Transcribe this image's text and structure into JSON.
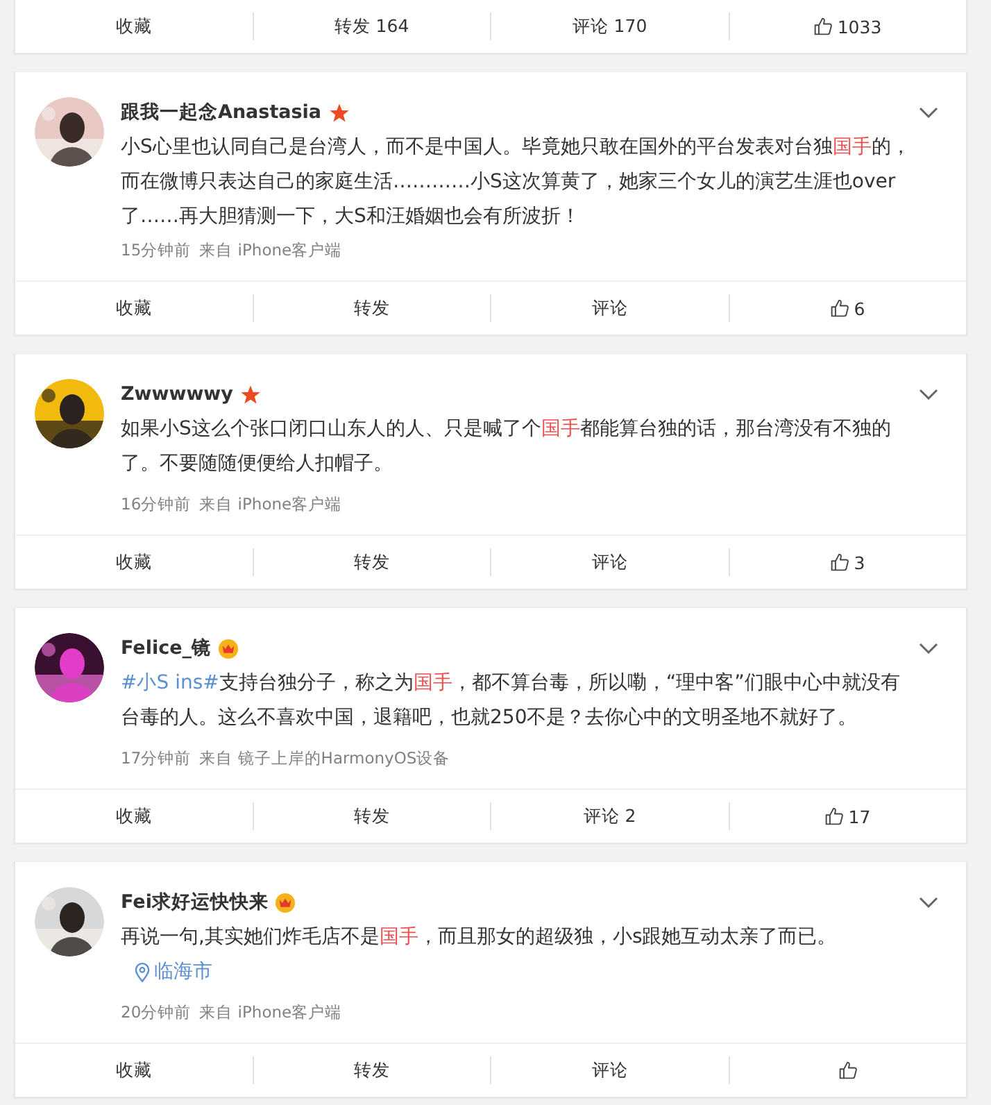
{
  "top_card": {
    "actions": [
      {
        "kind": "favorite",
        "label": "收藏"
      },
      {
        "kind": "repost",
        "label": "转发 164"
      },
      {
        "kind": "comment",
        "label": "评论 170"
      },
      {
        "kind": "like",
        "count": "1033"
      }
    ]
  },
  "comments": [
    {
      "name": "跟我一起念Anastasia",
      "badge": {
        "kind": "star"
      },
      "text": [
        {
          "kind": "plain",
          "text": "小S心里也认同自己是台湾人，而不是中国人。毕竟她只敢在国外的平台发表对台独"
        },
        {
          "kind": "keyword",
          "text": "国手"
        },
        {
          "kind": "plain",
          "text": "的，而在微博只表达自己的家庭生活…………小S这次算黄了，她家三个女儿的演艺生涯也over了……再大胆猜测一下，大S和汪婚姻也会有所波折！"
        }
      ],
      "time": "15分钟前",
      "source": "来自 iPhone客户端",
      "actions": [
        {
          "kind": "favorite",
          "label": "收藏"
        },
        {
          "kind": "repost",
          "label": "转发"
        },
        {
          "kind": "comment",
          "label": "评论"
        },
        {
          "kind": "like",
          "count": "6"
        }
      ]
    },
    {
      "name": "Zwwwwwy",
      "badge": {
        "kind": "star"
      },
      "text": [
        {
          "kind": "plain",
          "text": "如果小S这么个张口闭口山东人的人、只是喊了个"
        },
        {
          "kind": "keyword",
          "text": "国手"
        },
        {
          "kind": "plain",
          "text": "都能算台独的话，那台湾没有不独的了。不要随随便便给人扣帽子。"
        }
      ],
      "time": "16分钟前",
      "source": "来自 iPhone客户端",
      "actions": [
        {
          "kind": "favorite",
          "label": "收藏"
        },
        {
          "kind": "repost",
          "label": "转发"
        },
        {
          "kind": "comment",
          "label": "评论"
        },
        {
          "kind": "like",
          "count": "3"
        }
      ]
    },
    {
      "name": "Felice_镜",
      "badge": {
        "kind": "crown"
      },
      "text": [
        {
          "kind": "topic",
          "text": "#小S ins#"
        },
        {
          "kind": "plain",
          "text": "支持台独分子，称之为"
        },
        {
          "kind": "keyword",
          "text": "国手"
        },
        {
          "kind": "plain",
          "text": "，都不算台毒，所以嘞，“理中客”们眼中心中就没有台毒的人。这么不喜欢中国，退籍吧，也就250不是？去你心中的文明圣地不就好了。"
        }
      ],
      "time": "17分钟前",
      "source": "来自 镜子上岸的HarmonyOS设备",
      "actions": [
        {
          "kind": "favorite",
          "label": "收藏"
        },
        {
          "kind": "repost",
          "label": "转发"
        },
        {
          "kind": "comment",
          "label": "评论 2"
        },
        {
          "kind": "like",
          "count": "17"
        }
      ]
    },
    {
      "name": "Fei求好运快快来",
      "badge": {
        "kind": "crown"
      },
      "text": [
        {
          "kind": "plain",
          "text": "再说一句,其实她们炸毛店不是"
        },
        {
          "kind": "keyword",
          "text": "国手"
        },
        {
          "kind": "plain",
          "text": "，而且那女的超级独，小s跟她互动太亲了而已。"
        }
      ],
      "location": "临海市",
      "time": "20分钟前",
      "source": "来自 iPhone客户端",
      "actions": [
        {
          "kind": "favorite",
          "label": "收藏"
        },
        {
          "kind": "repost",
          "label": "转发"
        },
        {
          "kind": "comment",
          "label": "评论"
        },
        {
          "kind": "like"
        }
      ]
    }
  ]
}
